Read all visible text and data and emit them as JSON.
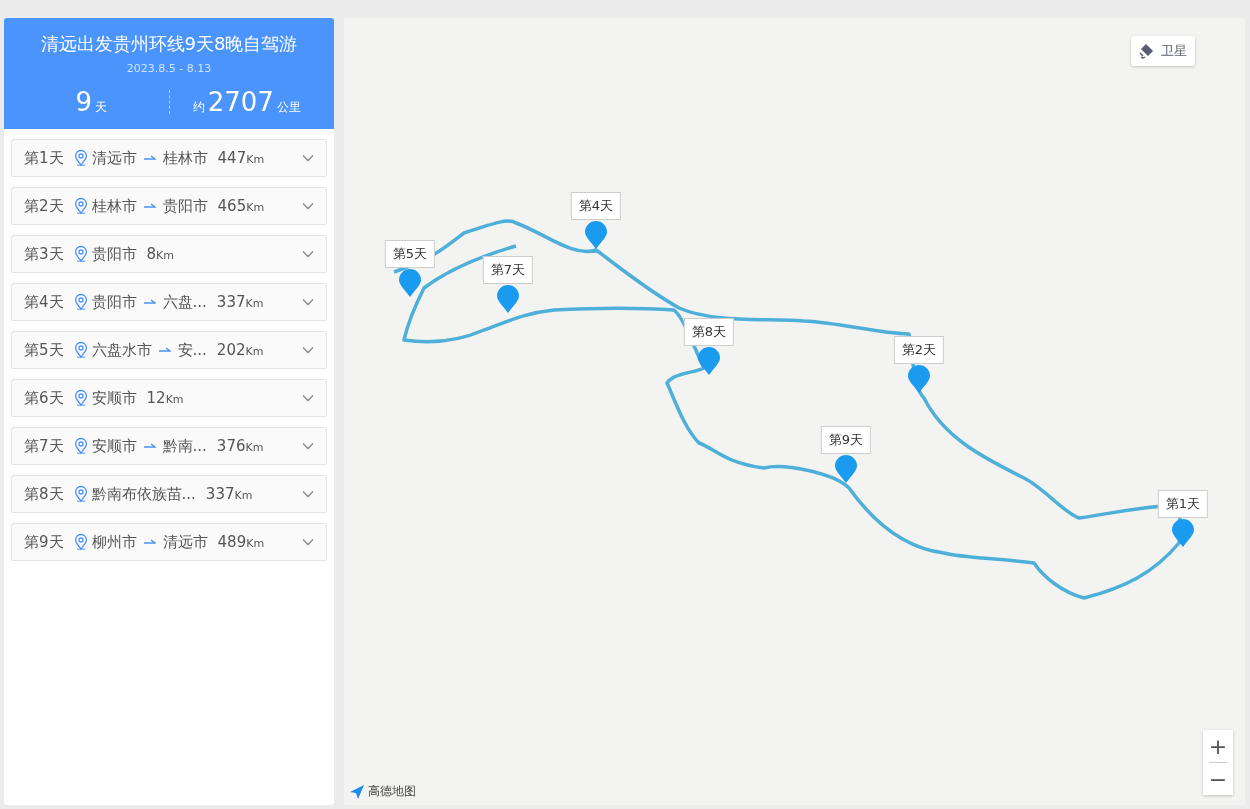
{
  "trip": {
    "title": "清远出发贵州环线9天8晚自驾游",
    "dates": "2023.8.5 - 8.13",
    "days": "9",
    "days_unit": "天",
    "distance_prefix": "约",
    "distance": "2707",
    "distance_unit": "公里"
  },
  "days": [
    {
      "day": "第1天",
      "from": "清远市",
      "to": "桂林市",
      "distance": "447",
      "unit": "Km",
      "expanded": false
    },
    {
      "day": "第2天",
      "from": "桂林市",
      "to": "贵阳市",
      "distance": "465",
      "unit": "Km",
      "expanded": false
    },
    {
      "day": "第3天",
      "from": "贵阳市",
      "distance": "8",
      "unit": "Km",
      "expanded": false
    },
    {
      "day": "第4天",
      "from": "贵阳市",
      "to": "六盘...",
      "distance": "337",
      "unit": "Km",
      "expanded": false
    },
    {
      "day": "第5天",
      "from": "六盘水市",
      "to": "安...",
      "distance": "202",
      "unit": "Km",
      "expanded": false
    },
    {
      "day": "第6天",
      "from": "安顺市",
      "distance": "12",
      "unit": "Km",
      "expanded": false
    },
    {
      "day": "第7天",
      "from": "安顺市",
      "to": "黔南...",
      "distance": "376",
      "unit": "Km",
      "expanded": false
    },
    {
      "day": "第8天",
      "from": "黔南布依族苗...",
      "distance": "337",
      "unit": "Km",
      "expanded": false
    },
    {
      "day": "第9天",
      "from": "柳州市",
      "to": "清远市",
      "distance": "489",
      "unit": "Km",
      "expanded": false
    }
  ],
  "map": {
    "satellite_button": "卫星",
    "logo": "高德地图",
    "zoom_in": "+",
    "zoom_out": "−",
    "markers": [
      {
        "label": "第5天"
      },
      {
        "label": "第7天"
      },
      {
        "label": "第4天"
      },
      {
        "label": "第8天"
      },
      {
        "label": "第2天"
      },
      {
        "label": "第9天"
      },
      {
        "label": "第1天"
      }
    ]
  }
}
